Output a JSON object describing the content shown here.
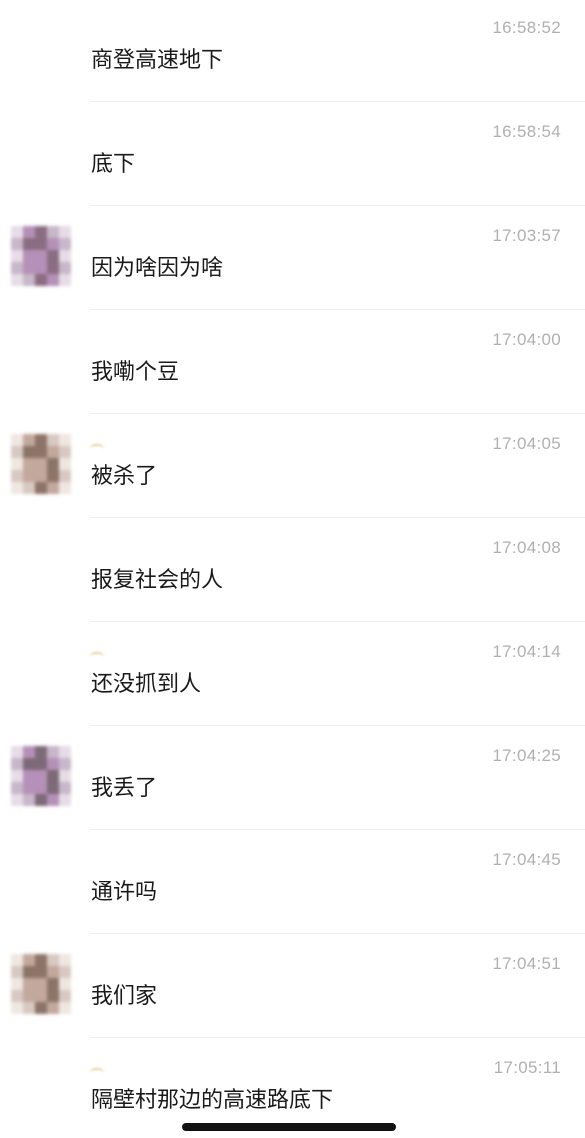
{
  "messages": [
    {
      "time": "16:58:52",
      "text": "商登高速地下",
      "avatar": false,
      "name_mark": false
    },
    {
      "time": "16:58:54",
      "text": "底下",
      "avatar": false,
      "name_mark": false
    },
    {
      "time": "17:03:57",
      "text": "因为啥因为啥",
      "avatar": true,
      "avatar_palette": [
        "#c7b7c9",
        "#8a6d82",
        "#b590b8",
        "#e6dde6"
      ],
      "name_mark": false
    },
    {
      "time": "17:04:00",
      "text": "我嘞个豆",
      "avatar": false,
      "name_mark": false
    },
    {
      "time": "17:04:05",
      "text": "被杀了",
      "avatar": true,
      "avatar_palette": [
        "#d7c9c2",
        "#8d7468",
        "#c3a89c",
        "#efe7e2"
      ],
      "name_mark": true
    },
    {
      "time": "17:04:08",
      "text": "报复社会的人",
      "avatar": false,
      "name_mark": false
    },
    {
      "time": "17:04:14",
      "text": "还没抓到人",
      "avatar": false,
      "name_mark": true
    },
    {
      "time": "17:04:25",
      "text": "我丢了",
      "avatar": true,
      "avatar_palette": [
        "#c7b7c9",
        "#7d6a78",
        "#b590b8",
        "#e6dde6"
      ],
      "name_mark": false
    },
    {
      "time": "17:04:45",
      "text": "通许吗",
      "avatar": false,
      "name_mark": false
    },
    {
      "time": "17:04:51",
      "text": "我们家",
      "avatar": true,
      "avatar_palette": [
        "#d7c9c2",
        "#8d7468",
        "#c3a89c",
        "#efe7e2"
      ],
      "name_mark": false
    },
    {
      "time": "17:05:11",
      "text": "隔壁村那边的高速路底下",
      "avatar": false,
      "name_mark": true
    }
  ]
}
